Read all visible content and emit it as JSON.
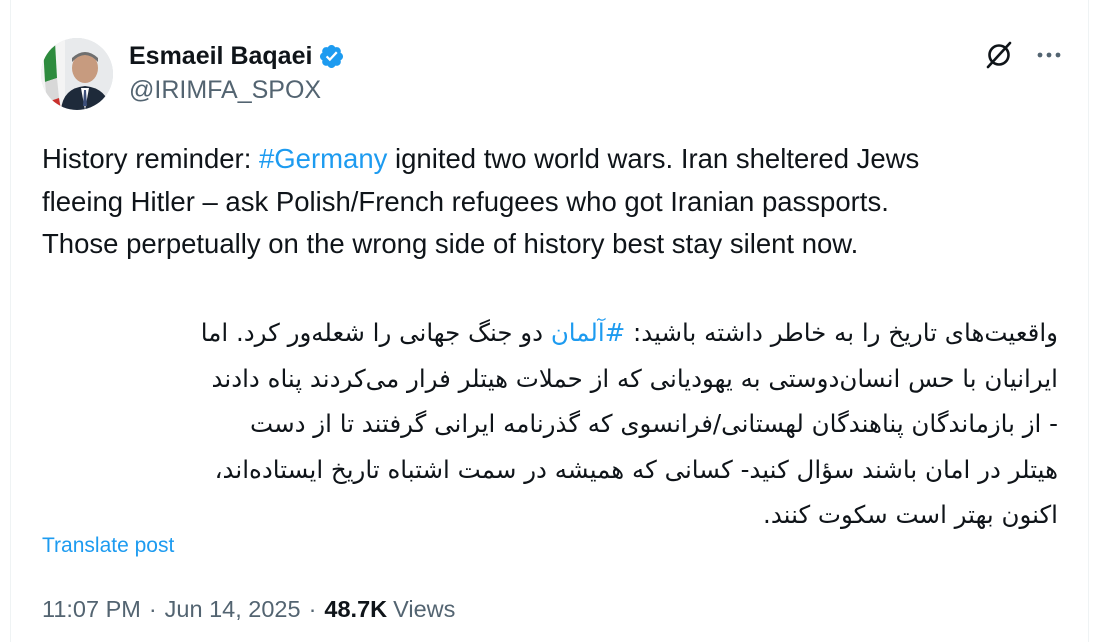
{
  "author": {
    "display_name": "Esmaeil Baqaei",
    "handle": "@IRIMFA_SPOX",
    "verified": true
  },
  "icons": {
    "verified": "verified-badge-icon",
    "grok": "grok-icon",
    "more": "more-options-icon"
  },
  "colors": {
    "accent": "#1d9bf0",
    "text": "#0f1419",
    "muted": "#536471"
  },
  "tweet": {
    "en_lines": [
      {
        "before": "History reminder: ",
        "hashtag": "#Germany",
        "after": " ignited two world wars. Iran sheltered Jews"
      },
      {
        "text": "fleeing Hitler – ask Polish/French refugees who got Iranian passports."
      },
      {
        "text": "Those perpetually on the wrong side of history best stay silent now."
      }
    ],
    "fa_lines": [
      {
        "before": "واقعیت‌های تاریخ را به خاطر داشته باشید: ",
        "hashtag": "#آلمان",
        "after": " دو جنگ جهانی را شعله‌ور کرد. اما"
      },
      {
        "text": "ایرانیان با حس انسان‌دوستی به یهودیانی که از حملات هیتلر فرار می‌کردند پناه دادند"
      },
      {
        "text": "- از بازماندگان پناهندگان لهستانی/فرانسوی که گذرنامه ایرانی گرفتند تا از دست"
      },
      {
        "text": "هیتلر در امان باشند سؤال کنید- کسانی که همیشه در سمت اشتباه تاریخ ایستاده‌اند،"
      },
      {
        "text": "اکنون بهتر است سکوت کنند."
      }
    ],
    "translate_label": "Translate post"
  },
  "meta": {
    "time": "11:07 PM",
    "separator": "·",
    "date": "Jun 14, 2025",
    "views_count": "48.7K",
    "views_label": "Views"
  }
}
